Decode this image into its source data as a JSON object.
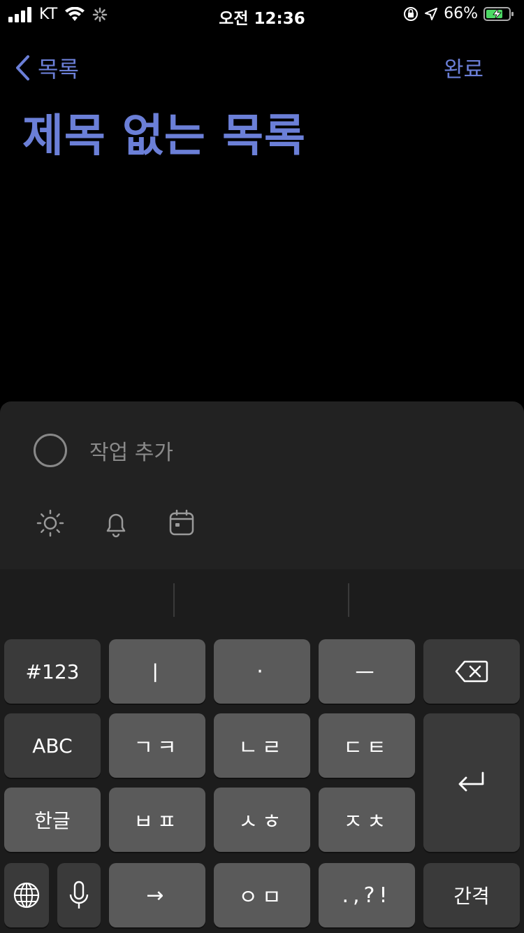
{
  "status_bar": {
    "carrier": "KT",
    "time": "오전 12:36",
    "battery": "66%"
  },
  "nav": {
    "back_label": "목록",
    "done_label": "완료"
  },
  "list_title": "제목 없는 목록",
  "task_panel": {
    "placeholder": "작업 추가"
  },
  "keyboard": {
    "row1": [
      "#123",
      "ㅣ",
      "·",
      "ㅡ"
    ],
    "row2": [
      "ABC",
      "ㄱㅋ",
      "ㄴㄹ",
      "ㄷㅌ"
    ],
    "row3": [
      "한글",
      "ㅂㅍ",
      "ㅅㅎ",
      "ㅈㅊ"
    ],
    "row4": [
      "→",
      "ㅇㅁ",
      ".,?!",
      "간격"
    ]
  },
  "colors": {
    "accent": "#6B7FD7",
    "background": "#000000",
    "panel": "#222222",
    "key": "#5A5A5A",
    "key_dark": "#3A3A3A"
  }
}
